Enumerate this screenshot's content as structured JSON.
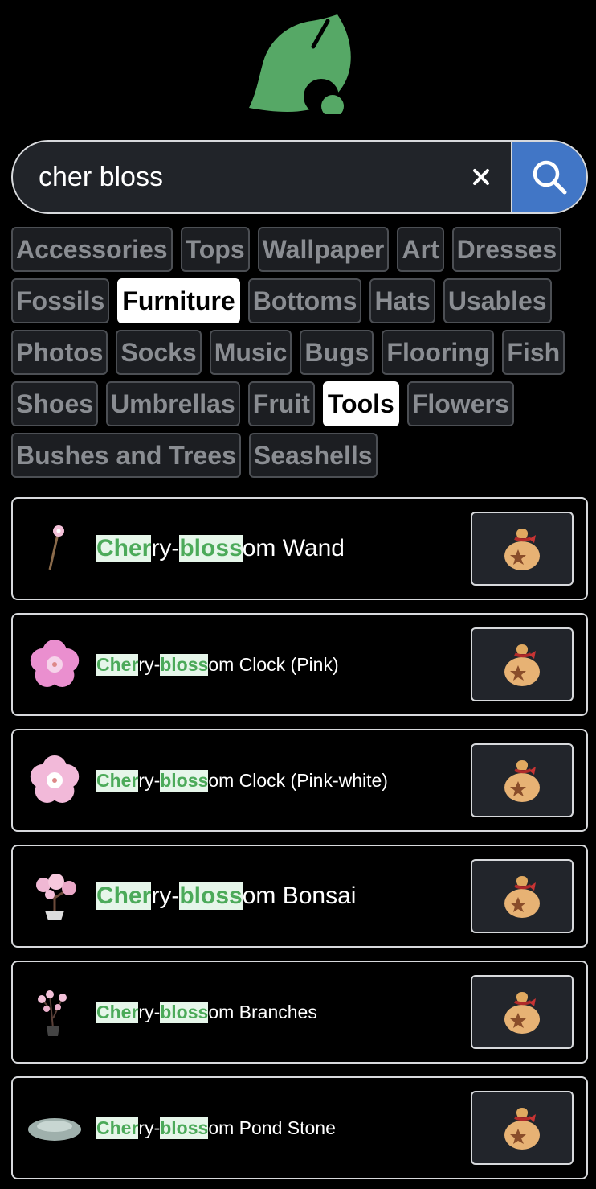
{
  "colors": {
    "accent_green": "#4caa5a",
    "search_blue": "#4176c6",
    "highlight_bg": "#e6f6ea"
  },
  "search": {
    "value": "cher bloss",
    "placeholder": ""
  },
  "icons": {
    "logo": "leaf-logo-icon",
    "clear": "close-icon",
    "search": "search-icon",
    "item_action": "money-bag-icon"
  },
  "categories": [
    [
      "Accessories",
      "Tops",
      "Wallpaper",
      "Art",
      "Dresses"
    ],
    [
      "Fossils",
      "Furniture",
      "Bottoms",
      "Hats",
      "Usables"
    ],
    [
      "Photos",
      "Socks",
      "Music",
      "Bugs",
      "Flooring",
      "Fish"
    ],
    [
      "Shoes",
      "Umbrellas",
      "Fruit",
      "Tools",
      "Flowers"
    ],
    [
      "Bushes and Trees",
      "Seashells"
    ]
  ],
  "active_categories": [
    "Furniture",
    "Tools"
  ],
  "results": [
    {
      "prefix": "Cher",
      "mid": "ry-",
      "match": "bloss",
      "suffix": "om Wand",
      "size": "lg",
      "thumb": "wand"
    },
    {
      "prefix": "Cher",
      "mid": "ry-",
      "match": "bloss",
      "suffix": "om Clock (Pink)",
      "size": "sm",
      "thumb": "flower-pink"
    },
    {
      "prefix": "Cher",
      "mid": "ry-",
      "match": "bloss",
      "suffix": "om Clock (Pink-white)",
      "size": "sm",
      "thumb": "flower-white"
    },
    {
      "prefix": "Cher",
      "mid": "ry-",
      "match": "bloss",
      "suffix": "om Bonsai",
      "size": "lg",
      "thumb": "bonsai"
    },
    {
      "prefix": "Cher",
      "mid": "ry-",
      "match": "bloss",
      "suffix": "om Branches",
      "size": "sm",
      "thumb": "branches"
    },
    {
      "prefix": "Cher",
      "mid": "ry-",
      "match": "bloss",
      "suffix": "om Pond Stone",
      "size": "sm",
      "thumb": "stone"
    }
  ]
}
